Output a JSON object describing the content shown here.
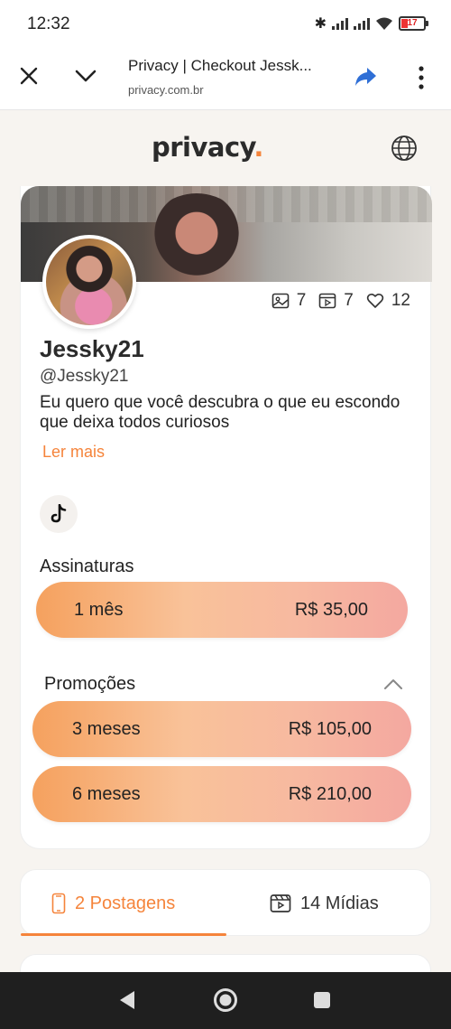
{
  "status_bar": {
    "time": "12:32",
    "battery": "17"
  },
  "browser": {
    "title": "Privacy | Checkout Jessk...",
    "url": "privacy.com.br"
  },
  "site": {
    "logo_text": "privacy",
    "logo_dot": "."
  },
  "profile": {
    "name": "Jessky21",
    "handle": "@Jessky21",
    "bio": "Eu quero que você descubra o que eu escondo que deixa todos curiosos",
    "read_more": "Ler mais",
    "stats": {
      "images": "7",
      "videos": "7",
      "likes": "12"
    }
  },
  "subscriptions": {
    "title": "Assinaturas",
    "plans": [
      {
        "label": "1 mês",
        "price": "R$ 35,00"
      }
    ]
  },
  "promotions": {
    "title": "Promoções",
    "plans": [
      {
        "label": "3 meses",
        "price": "R$ 105,00"
      },
      {
        "label": "6 meses",
        "price": "R$ 210,00"
      }
    ]
  },
  "tabs": [
    {
      "label": "2 Postagens",
      "active": true
    },
    {
      "label": "14 Mídias",
      "active": false
    }
  ],
  "colors": {
    "accent": "#f5843b",
    "text": "#2b2b2b",
    "background": "#f7f4f0"
  },
  "icons": [
    "close-icon",
    "chevron-down-icon",
    "share-icon",
    "more-vert-icon",
    "globe-icon",
    "image-icon",
    "video-icon",
    "heart-icon",
    "tiktok-icon",
    "chevron-up-icon",
    "phone-icon",
    "media-icon",
    "back-icon",
    "home-icon",
    "recents-icon"
  ]
}
